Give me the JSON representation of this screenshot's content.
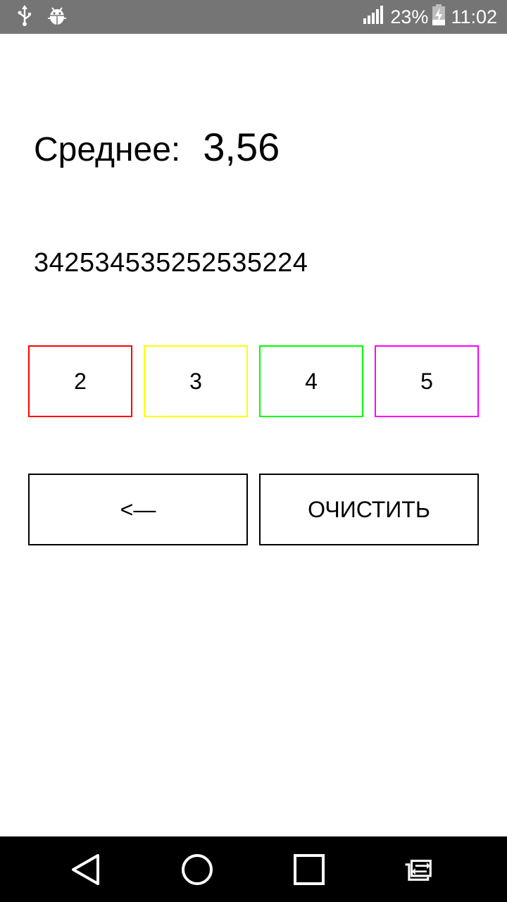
{
  "status_bar": {
    "battery_percent": "23%",
    "time": "11:02",
    "icons": [
      "usb-icon",
      "android-debug-icon",
      "signal-icon",
      "battery-charging-icon"
    ]
  },
  "main": {
    "average_label": "Среднее:",
    "average_value": "3,56",
    "grades_string": "342534535252535224"
  },
  "grade_buttons": [
    {
      "label": "2",
      "color": "#ff0000"
    },
    {
      "label": "3",
      "color": "#ffff00"
    },
    {
      "label": "4",
      "color": "#00ff00"
    },
    {
      "label": "5",
      "color": "#ff00ff"
    }
  ],
  "actions": {
    "backspace_label": "<—",
    "clear_label": "ОЧИСТИТЬ"
  },
  "nav_bar": {
    "icons": [
      "back-icon",
      "home-icon",
      "recents-icon",
      "app-switch-icon"
    ]
  }
}
